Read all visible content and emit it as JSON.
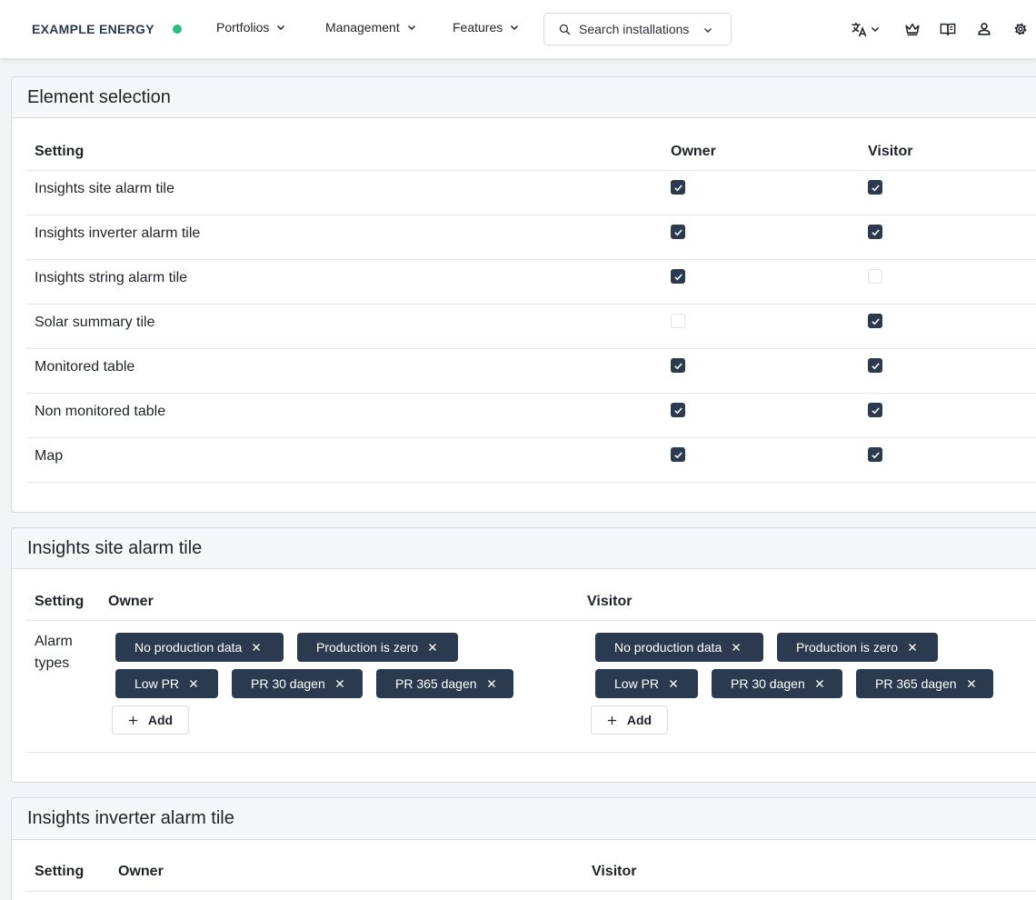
{
  "header": {
    "brand": "EXAMPLE ENERGY",
    "status_color": "#2bbf7e",
    "nav": [
      {
        "label": "Portfolios"
      },
      {
        "label": "Management"
      },
      {
        "label": "Features"
      }
    ],
    "search_placeholder": "Search installations",
    "icons": [
      "translate-icon",
      "crown-icon",
      "book-icon",
      "user-icon",
      "settings-icon"
    ]
  },
  "element_selection": {
    "title": "Element selection",
    "columns": {
      "setting": "Setting",
      "owner": "Owner",
      "visitor": "Visitor"
    },
    "rows": [
      {
        "label": "Insights site alarm tile",
        "owner": true,
        "visitor": true
      },
      {
        "label": "Insights inverter alarm tile",
        "owner": true,
        "visitor": true
      },
      {
        "label": "Insights string alarm tile",
        "owner": true,
        "visitor": false
      },
      {
        "label": "Solar summary tile",
        "owner": false,
        "visitor": true
      },
      {
        "label": "Monitored table",
        "owner": true,
        "visitor": true
      },
      {
        "label": "Non monitored table",
        "owner": true,
        "visitor": true
      },
      {
        "label": "Map",
        "owner": true,
        "visitor": true
      }
    ]
  },
  "site_alarm": {
    "title": "Insights site alarm tile",
    "columns": {
      "setting": "Setting",
      "owner": "Owner",
      "visitor": "Visitor"
    },
    "row_label_line1": "Alarm",
    "row_label_line2": "types",
    "owner_tags": [
      "No production data",
      "Production is zero",
      "Low PR",
      "PR 30 dagen",
      "PR 365 dagen"
    ],
    "visitor_tags": [
      "No production data",
      "Production is zero",
      "Low PR",
      "PR 30 dagen",
      "PR 365 dagen"
    ],
    "add_label": "Add"
  },
  "inverter_alarm": {
    "title": "Insights inverter alarm tile",
    "columns": {
      "setting": "Setting",
      "owner": "Owner",
      "visitor": "Visitor"
    }
  },
  "colors": {
    "primary": "#2b3a4e",
    "status": "#2bbf7e",
    "border": "#d8dbdf"
  }
}
